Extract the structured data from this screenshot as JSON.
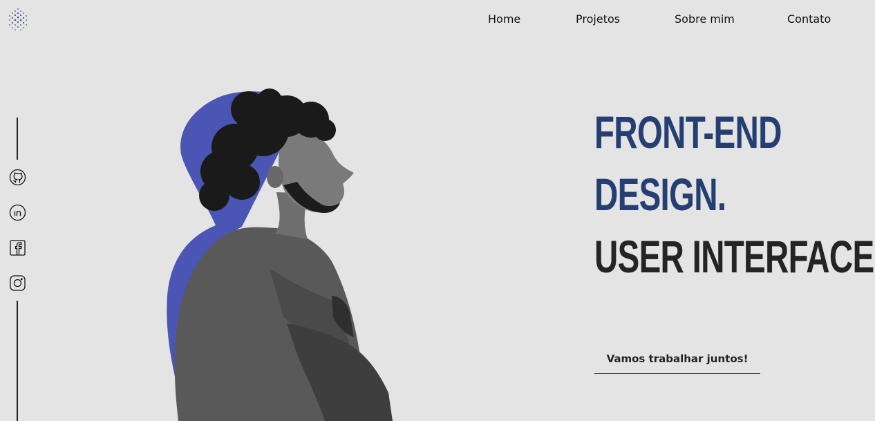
{
  "nav": {
    "items": [
      {
        "label": "Home"
      },
      {
        "label": "Projetos"
      },
      {
        "label": "Sobre mim"
      },
      {
        "label": "Contato"
      }
    ]
  },
  "social": {
    "icons": [
      "github-icon",
      "linkedin-icon",
      "facebook-icon",
      "instagram-icon"
    ]
  },
  "hero": {
    "headline": [
      "FRONT-END",
      "DESIGN.",
      "USER INTERFACE."
    ],
    "cta_label": "Vamos trabalhar juntos!"
  },
  "colors": {
    "background": "#e4e4e4",
    "accent_blue": "#253f73",
    "outline_blue": "#4a55b4",
    "text_dark": "#242424"
  }
}
